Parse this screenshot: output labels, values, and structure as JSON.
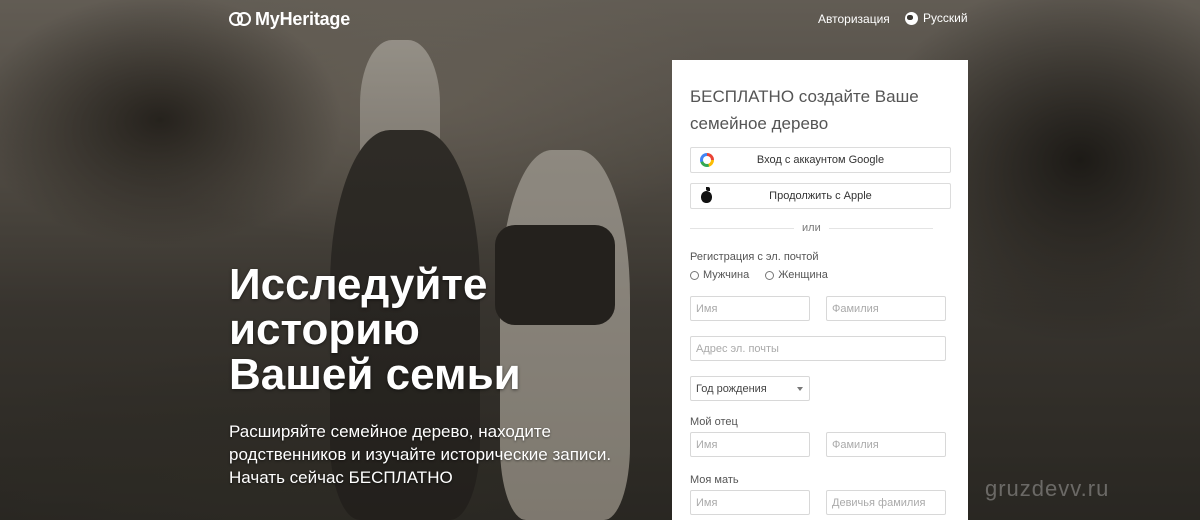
{
  "header": {
    "brand": "MyHeritage",
    "login_label": "Авторизация",
    "language_label": "Русский"
  },
  "hero": {
    "title_lines": [
      "Исследуйте",
      "историю",
      "Вашей семьи"
    ],
    "subtitle": "Расширяйте семейное дерево, находите родственников и изучайте исторические записи. Начать сейчас БЕСПЛАТНО"
  },
  "signup": {
    "title": "БЕСПЛАТНО создайте Ваше семейное дерево",
    "google_label": "Вход с аккаунтом Google",
    "apple_label": "Продолжить с Apple",
    "or_label": "или",
    "email_reg_label": "Регистрация с эл. почтой",
    "gender_options": [
      "Мужчина",
      "Женщина"
    ],
    "first_name_placeholder": "Имя",
    "last_name_placeholder": "Фамилия",
    "email_placeholder": "Адрес эл. почты",
    "birth_year_label": "Год рождения",
    "father_label": "Мой отец",
    "father_first_placeholder": "Имя",
    "father_last_placeholder": "Фамилия",
    "mother_label": "Моя мать",
    "mother_first_placeholder": "Имя",
    "mother_maiden_placeholder": "Девичья фамилия"
  },
  "watermark": "gruzdevv.ru"
}
